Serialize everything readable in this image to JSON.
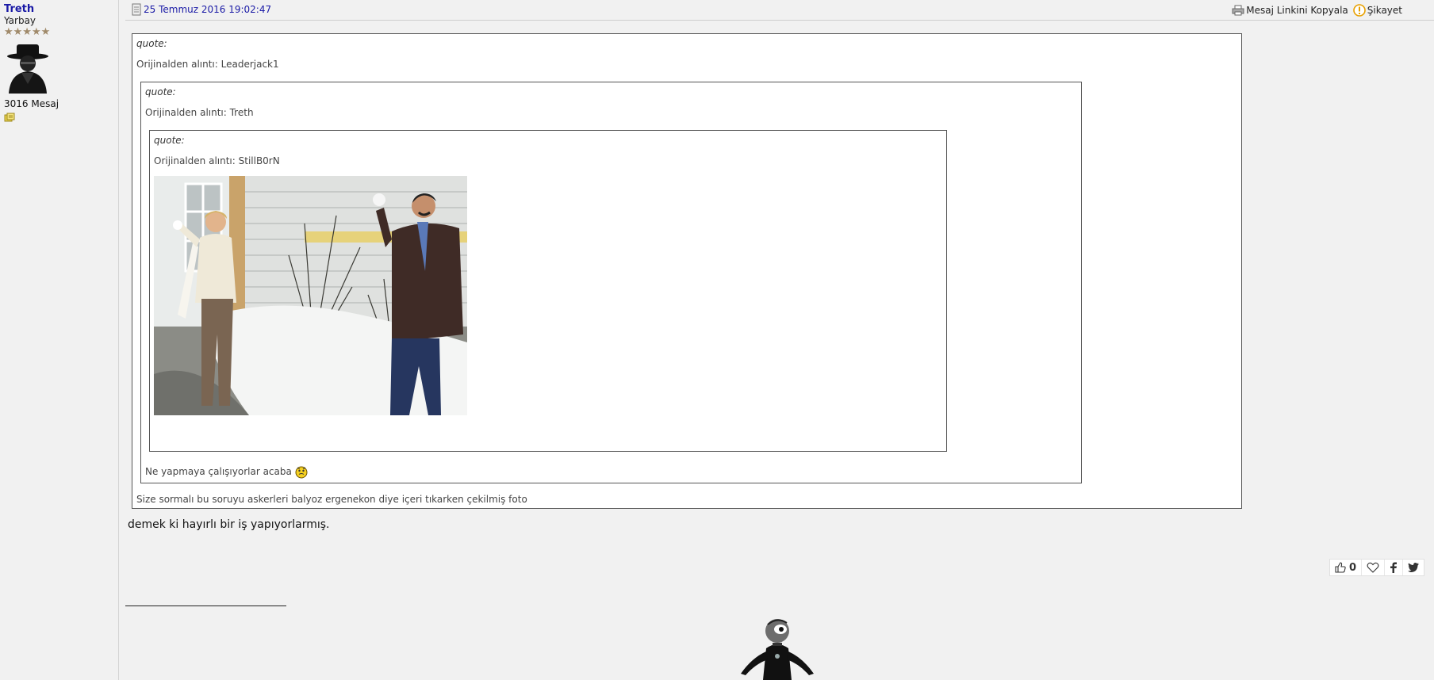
{
  "user": {
    "name": "Treth",
    "rank": "Yarbay",
    "stars": "★★★★★",
    "post_count": "3016 Mesaj"
  },
  "header": {
    "date": "25 Temmuz 2016 19:02:47",
    "copy_link": "Mesaj Linkini Kopyala",
    "report": "Şikayet"
  },
  "quotes": {
    "outer": {
      "label": "quote:",
      "from": "Orijinalden alıntı: Leaderjack1",
      "text": "Size sormalı bu soruyu askerleri balyoz ergenekon diye içeri tıkarken çekilmiş foto"
    },
    "middle": {
      "label": "quote:",
      "from": "Orijinalden alıntı: Treth",
      "text": "Ne yapmaya çalışıyorlar acaba"
    },
    "inner": {
      "label": "quote:",
      "from": "Orijinalden alıntı: StillB0rN"
    }
  },
  "post": {
    "text": "demek ki hayırlı bir iş yapıyorlarmış."
  },
  "reactions": {
    "like_count": "0"
  },
  "colors": {
    "link": "#1a1aa6",
    "report_icon": "#e8a000",
    "background": "#f1f1f1"
  }
}
